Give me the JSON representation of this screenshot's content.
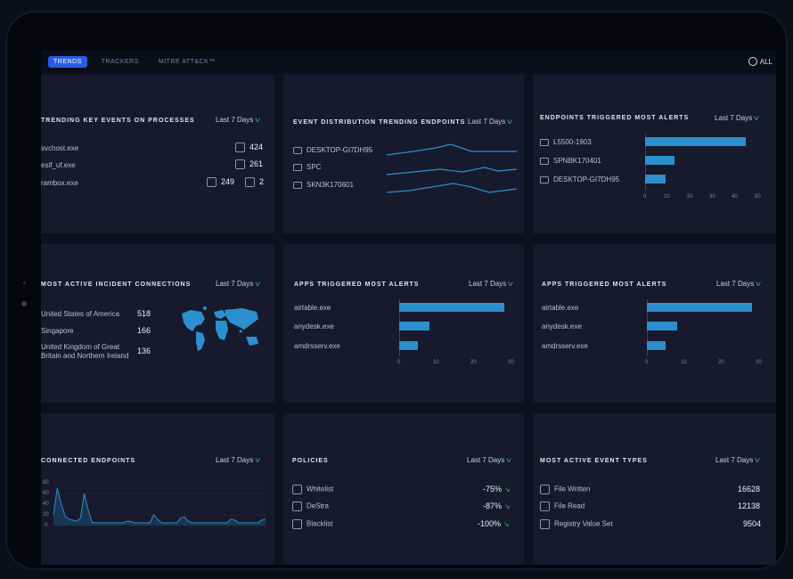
{
  "topbar": {
    "tabs": [
      "TRENDS",
      "TRACKERS",
      "MITRE ATT&CK™"
    ],
    "scope": "ALL"
  },
  "range_label": "Last 7 Days",
  "cards": {
    "key_events": {
      "title": "TRENDING KEY EVENTS ON PROCESSES",
      "rows": [
        {
          "name": "svchost.exe",
          "v1": "424"
        },
        {
          "name": "esif_uf.exe",
          "v1": "261"
        },
        {
          "name": "rambox.exe",
          "v1": "249",
          "v2": "2"
        }
      ]
    },
    "event_distribution": {
      "title": "EVENT DISTRIBUTION TRENDING ENDPOINTS",
      "rows": [
        "DESKTOP-GI7DH95",
        "SPC",
        "SKN3K170601"
      ]
    },
    "endpoints_alerts": {
      "title": "ENDPOINTS TRIGGERED MOST ALERTS",
      "rows": [
        "L5500-1903",
        "SPNBK170401",
        "DESKTOP-GI7DH95"
      ],
      "ticks": [
        "0",
        "10",
        "20",
        "30",
        "40",
        "50"
      ]
    },
    "incident_connections": {
      "title": "MOST ACTIVE INCIDENT CONNECTIONS",
      "rows": [
        {
          "name": "United States of America",
          "value": "518"
        },
        {
          "name": "Singapore",
          "value": "166"
        },
        {
          "name_line1": "United Kingdom of Great",
          "name_line2": "Britain and Northern Ireland",
          "value": "136"
        }
      ]
    },
    "apps_alerts_1": {
      "title": "APPS TRIGGERED MOST ALERTS",
      "rows": [
        "airtable.exe",
        "anydesk.exe",
        "amdrsserv.exe"
      ],
      "ticks": [
        "0",
        "10",
        "20",
        "30"
      ]
    },
    "apps_alerts_2": {
      "title": "APPS TRIGGERED MOST ALERTS",
      "rows": [
        "airtable.exe",
        "anydesk.exe",
        "amdrsserv.exe"
      ],
      "ticks": [
        "0",
        "10",
        "20",
        "30"
      ]
    },
    "connected_endpoints": {
      "title": "CONNECTED ENDPOINTS",
      "yticks": [
        "80",
        "60",
        "40",
        "20",
        "0"
      ]
    },
    "policies": {
      "title": "POLICIES",
      "rows": [
        {
          "name": "Whitelist",
          "value": "-75%"
        },
        {
          "name": "DeStra",
          "value": "-87%"
        },
        {
          "name": "Blacklist",
          "value": "-100%"
        }
      ]
    },
    "event_types": {
      "title": "MOST ACTIVE EVENT TYPES",
      "rows": [
        {
          "name": "File Written",
          "value": "16628"
        },
        {
          "name": "File Read",
          "value": "12138"
        },
        {
          "name": "Registry Value Set",
          "value": "9504"
        }
      ]
    }
  },
  "chart_data": [
    {
      "type": "bar",
      "categories": [
        "L5500-1903",
        "SPNBK170401",
        "DESKTOP-GI7DH95"
      ],
      "values": [
        44,
        13,
        9
      ],
      "title": "ENDPOINTS TRIGGERED MOST ALERTS",
      "xlim": [
        0,
        50
      ]
    },
    {
      "type": "bar",
      "categories": [
        "airtable.exe",
        "anydesk.exe",
        "amdrsserv.exe"
      ],
      "values": [
        28,
        8,
        5
      ],
      "title": "APPS TRIGGERED MOST ALERTS",
      "xlim": [
        0,
        30
      ]
    },
    {
      "type": "bar",
      "categories": [
        "airtable.exe",
        "anydesk.exe",
        "amdrsserv.exe"
      ],
      "values": [
        28,
        8,
        5
      ],
      "title": "APPS TRIGGERED MOST ALERTS",
      "xlim": [
        0,
        30
      ]
    },
    {
      "type": "area",
      "title": "CONNECTED ENDPOINTS",
      "values": [
        20,
        70,
        40,
        18,
        12,
        10,
        8,
        14,
        60,
        30,
        6,
        5,
        5,
        5,
        5,
        5,
        5,
        5,
        5,
        8,
        8,
        5,
        5,
        5,
        5,
        5,
        20,
        12,
        5,
        5,
        5,
        5,
        5,
        14,
        16,
        8,
        5,
        5,
        5,
        5,
        5,
        5,
        5,
        5,
        5,
        5,
        12,
        10,
        5,
        5,
        5,
        5,
        5,
        5,
        10,
        12
      ],
      "ylim": [
        0,
        80
      ]
    }
  ]
}
